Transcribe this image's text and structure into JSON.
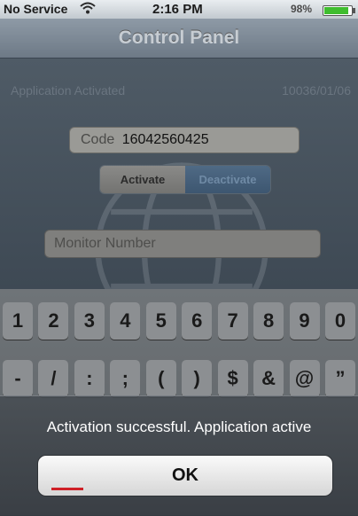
{
  "status_bar": {
    "carrier": "No Service",
    "time": "2:16 PM",
    "battery": "98%",
    "battery_level": 0.98,
    "wifi_icon": "wifi-icon"
  },
  "nav": {
    "title": "Control Panel"
  },
  "info": {
    "status": "Application Activated",
    "date": "10036/01/06"
  },
  "form": {
    "code_label": "Code",
    "code_value": "16042560425",
    "activate_label": "Activate",
    "deactivate_label": "Deactivate",
    "monitor_placeholder": "Monitor Number"
  },
  "keyboard": {
    "row1": [
      "1",
      "2",
      "3",
      "4",
      "5",
      "6",
      "7",
      "8",
      "9",
      "0"
    ],
    "row2": [
      "-",
      "/",
      ":",
      ";",
      "(",
      ")",
      "$",
      "&",
      "@",
      "”"
    ]
  },
  "alert": {
    "message": "Activation successful. Application active",
    "ok_label": "OK"
  }
}
